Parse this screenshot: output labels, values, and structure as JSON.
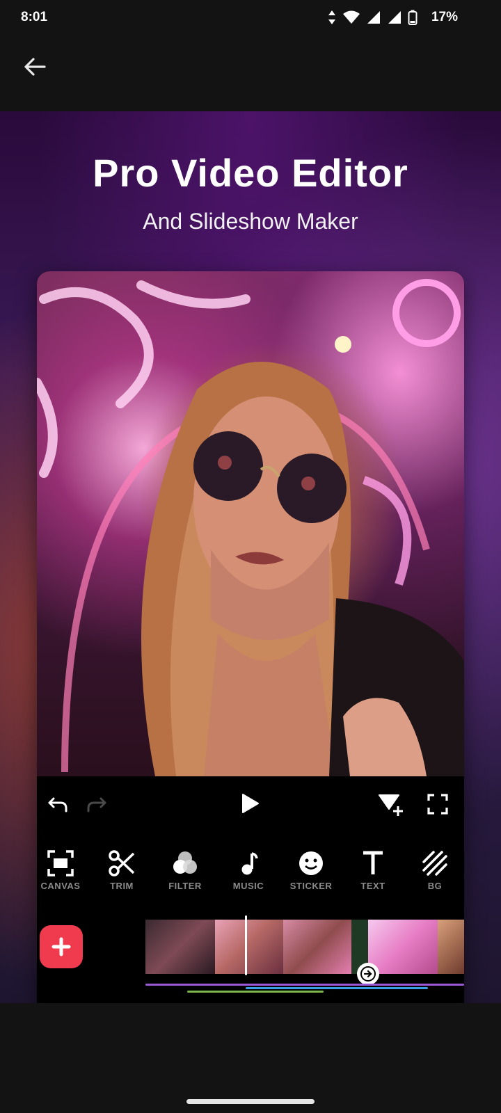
{
  "status": {
    "time": "8:01",
    "battery": "17%"
  },
  "hero": {
    "title": "Pro Video Editor",
    "subtitle": "And Slideshow Maker"
  },
  "editor": {
    "tools": [
      {
        "label": "CANVAS",
        "icon": "canvas-icon"
      },
      {
        "label": "TRIM",
        "icon": "scissors-icon"
      },
      {
        "label": "FILTER",
        "icon": "filter-icon"
      },
      {
        "label": "MUSIC",
        "icon": "music-note-icon"
      },
      {
        "label": "STICKER",
        "icon": "smiley-icon"
      },
      {
        "label": "TEXT",
        "icon": "text-icon"
      },
      {
        "label": "BG",
        "icon": "background-icon"
      }
    ]
  },
  "colors": {
    "accent": "#ef3b4d",
    "background": "#131313",
    "track_purple": "#9b59d6",
    "track_blue": "#3aa0e6",
    "track_green": "#7ab648"
  }
}
